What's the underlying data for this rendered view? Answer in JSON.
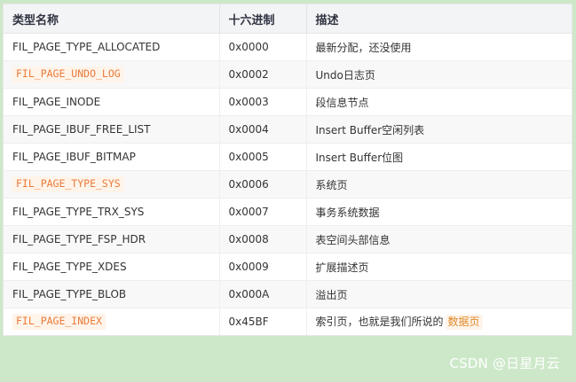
{
  "table": {
    "headers": {
      "name": "类型名称",
      "hex": "十六进制",
      "desc": "描述"
    },
    "rows": [
      {
        "name": "FIL_PAGE_TYPE_ALLOCATED",
        "name_highlight": false,
        "hex": "0x0000",
        "desc": "最新分配，还没使用",
        "desc_tail": "",
        "desc_tail_highlight": ""
      },
      {
        "name": "FIL_PAGE_UNDO_LOG",
        "name_highlight": true,
        "hex": "0x0002",
        "desc": "Undo日志页",
        "desc_tail": "",
        "desc_tail_highlight": ""
      },
      {
        "name": "FIL_PAGE_INODE",
        "name_highlight": false,
        "hex": "0x0003",
        "desc": "段信息节点",
        "desc_tail": "",
        "desc_tail_highlight": ""
      },
      {
        "name": "FIL_PAGE_IBUF_FREE_LIST",
        "name_highlight": false,
        "hex": "0x0004",
        "desc": "Insert Buffer空闲列表",
        "desc_tail": "",
        "desc_tail_highlight": ""
      },
      {
        "name": "FIL_PAGE_IBUF_BITMAP",
        "name_highlight": false,
        "hex": "0x0005",
        "desc": "Insert Buffer位图",
        "desc_tail": "",
        "desc_tail_highlight": ""
      },
      {
        "name": "FIL_PAGE_TYPE_SYS",
        "name_highlight": true,
        "hex": "0x0006",
        "desc": "系统页",
        "desc_tail": "",
        "desc_tail_highlight": ""
      },
      {
        "name": "FIL_PAGE_TYPE_TRX_SYS",
        "name_highlight": false,
        "hex": "0x0007",
        "desc": "事务系统数据",
        "desc_tail": "",
        "desc_tail_highlight": ""
      },
      {
        "name": "FIL_PAGE_TYPE_FSP_HDR",
        "name_highlight": false,
        "hex": "0x0008",
        "desc": "表空间头部信息",
        "desc_tail": "",
        "desc_tail_highlight": ""
      },
      {
        "name": "FIL_PAGE_TYPE_XDES",
        "name_highlight": false,
        "hex": "0x0009",
        "desc": "扩展描述页",
        "desc_tail": "",
        "desc_tail_highlight": ""
      },
      {
        "name": "FIL_PAGE_TYPE_BLOB",
        "name_highlight": false,
        "hex": "0x000A",
        "desc": "溢出页",
        "desc_tail": "",
        "desc_tail_highlight": ""
      },
      {
        "name": "FIL_PAGE_INDEX",
        "name_highlight": true,
        "hex": "0x45BF",
        "desc": "索引页，也就是我们所说的",
        "desc_tail": "",
        "desc_tail_highlight": "数据页"
      }
    ]
  },
  "watermark": "CSDN @日星月云",
  "colors": {
    "background": "#cde8c9",
    "header_bg": "#f3f4f6",
    "highlight_text": "#ea7b3a",
    "highlight_bg": "#fff4ea",
    "text": "#333333"
  }
}
